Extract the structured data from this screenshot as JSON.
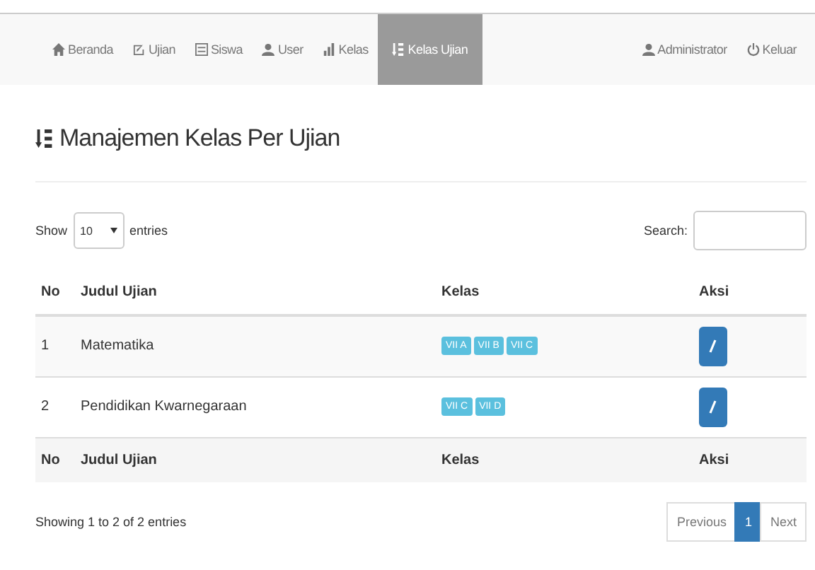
{
  "navbar": {
    "items": [
      {
        "label": "Beranda",
        "kind": "home",
        "selected": false
      },
      {
        "label": "Ujian",
        "kind": "edit",
        "selected": false
      },
      {
        "label": "Siswa",
        "kind": "list",
        "selected": false
      },
      {
        "label": "User",
        "kind": "user",
        "selected": false
      },
      {
        "label": "Kelas",
        "kind": "chart",
        "selected": false
      },
      {
        "label": "Kelas Ujian",
        "kind": "sort",
        "selected": true
      }
    ],
    "right_items": [
      {
        "label": "Administrator",
        "kind": "user"
      },
      {
        "label": "Keluar",
        "kind": "power"
      }
    ]
  },
  "title": "Manajemen Kelas Per Ujian",
  "length_menu": {
    "show": "Show",
    "value": "10",
    "entries": "entries"
  },
  "search": {
    "label": "Search:"
  },
  "table": {
    "columns": [
      "No",
      "Judul Ujian",
      "Kelas",
      "Aksi"
    ],
    "rows": [
      {
        "no": "1",
        "judul": "Matematika",
        "kelas": [
          "VII A",
          "VII B",
          "VII C"
        ]
      },
      {
        "no": "2",
        "judul": "Pendidikan Kwarnegaraan",
        "kelas": [
          "VII C",
          "VII D"
        ]
      }
    ],
    "footer": [
      "No",
      "Judul Ujian",
      "Kelas",
      "Aksi"
    ]
  },
  "info": "Showing 1 to 2 of 2 entries",
  "pagination": [
    {
      "label": "Previous",
      "selected": false
    },
    {
      "label": "1",
      "selected": true
    },
    {
      "label": "Next",
      "selected": false
    }
  ]
}
